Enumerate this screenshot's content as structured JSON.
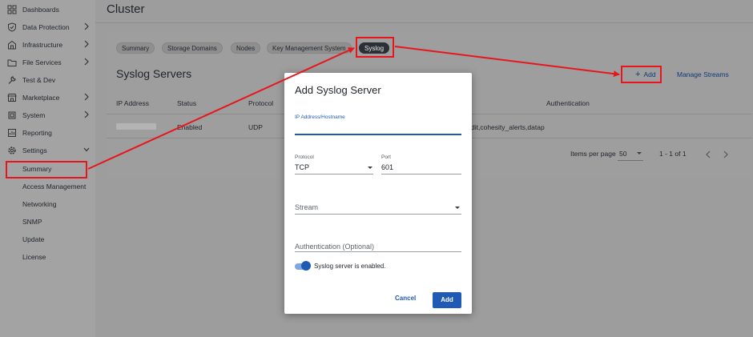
{
  "sidebar": {
    "items": [
      {
        "label": "Dashboards",
        "icon": "dashboard-icon",
        "chevron": false
      },
      {
        "label": "Data Protection",
        "icon": "shield-icon",
        "chevron": true
      },
      {
        "label": "Infrastructure",
        "icon": "infrastructure-icon",
        "chevron": true
      },
      {
        "label": "File Services",
        "icon": "folder-icon",
        "chevron": true
      },
      {
        "label": "Test & Dev",
        "icon": "wrench-icon",
        "chevron": false
      },
      {
        "label": "Marketplace",
        "icon": "store-icon",
        "chevron": true
      },
      {
        "label": "System",
        "icon": "system-icon",
        "chevron": true
      },
      {
        "label": "Reporting",
        "icon": "report-icon",
        "chevron": false
      },
      {
        "label": "Settings",
        "icon": "gear-icon",
        "chevron": true
      }
    ],
    "settings_sub": [
      "Summary",
      "Access Management",
      "Networking",
      "SNMP",
      "Update",
      "License"
    ]
  },
  "page": {
    "title": "Cluster"
  },
  "tabs": [
    "Summary",
    "Storage Domains",
    "Nodes",
    "Key Management System",
    "Syslog"
  ],
  "section": {
    "title": "Syslog Servers",
    "add_label": "Add",
    "manage_label": "Manage Streams"
  },
  "table": {
    "headers": [
      "IP Address",
      "Status",
      "Protocol",
      "Authentication"
    ],
    "row": {
      "status": "Enabled",
      "protocol": "UDP",
      "streams": "dit,cohesity_alerts,datap"
    }
  },
  "pager": {
    "items_per_page_label": "Items per page",
    "items_per_page_value": "50",
    "range": "1 - 1 of 1"
  },
  "modal": {
    "title": "Add Syslog Server",
    "ip_label": "IP Address/Hostname",
    "protocol_label": "Protocol",
    "protocol_value": "TCP",
    "port_label": "Port",
    "port_value": "601",
    "stream_placeholder": "Stream",
    "auth_placeholder": "Authentication (Optional)",
    "toggle_label": "Syslog server is enabled.",
    "cancel_label": "Cancel",
    "add_label": "Add"
  },
  "colors": {
    "accent": "#1f5bb5",
    "annotation": "#e8151c",
    "active_tab": "#2a3035"
  }
}
